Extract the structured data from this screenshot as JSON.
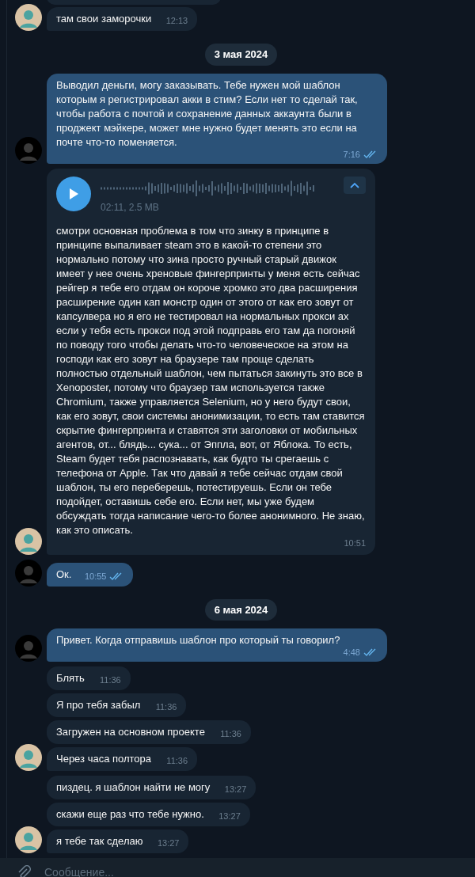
{
  "messages": [
    {
      "kind": "group",
      "outgoing": false,
      "cut_top": true,
      "messages": [
        {
          "kind": "text",
          "text": "там свои заморочки",
          "time": "12:13"
        }
      ]
    },
    {
      "kind": "date",
      "text": "3 мая 2024"
    },
    {
      "kind": "group",
      "outgoing": true,
      "messages": [
        {
          "kind": "text",
          "text": "Выводил деньги, могу заказывать. Тебе нужен мой шаблон которым я регистрировал акки в стим? Если нет то сделай так, чтобы работа с почтой и сохранение данных аккаунта были в проджект мэйкере, может мне нужно будет менять это если на почте что-то поменяется.",
          "time": "7:16",
          "read": true
        }
      ]
    },
    {
      "kind": "group",
      "outgoing": false,
      "messages": [
        {
          "kind": "voice",
          "meta": "02:11, 2.5 MB",
          "expanded": true,
          "text": "смотри основная проблема в том что зинку в принципе в принципе выпаливает steam это в какой-то степени это нормально потому что зина просто ручный старый движок имеет у нее очень хреновые фингерпринты у меня есть сейчас рейгер я тебе его отдам он короче хромко это два расширения расширение один кап монстр один от этого от как его зовут от капсулвера но я его не тестировал на нормальных прокси ах если у тебя есть прокси под этой подправь его там да погоняй по поводу того чтобы делать что-то человеческое на этом на господи как его зовут на браузере там проще сделать полностью отдельный шаблон, чем пытаться закинуть это все в Xenoposter, потому что браузер там используется также Chromium, также управляется Selenium, но у него будут свои, как его зовут, свои системы анонимизации, то есть там ставится скрытие фингерпринта и ставятся эти заголовки от мобильных агентов, от... блядь... сука... от Эппла, вот, от Яблока. То есть, Steam будет тебя распознавать, как будто ты срегаешь с телефона от Apple. Так что давай я тебе сейчас отдам свой шаблон, ты его переберешь, потестируешь. Если он тебе подойдет, оставишь себе его. Если нет, мы уже будем обсуждать тогда написание чего-то более анонимного. Не знаю, как это описать.",
          "time": "10:51"
        }
      ]
    },
    {
      "kind": "group",
      "outgoing": true,
      "messages": [
        {
          "kind": "text",
          "text": "Ок.",
          "time": "10:55",
          "read": true
        }
      ]
    },
    {
      "kind": "date",
      "text": "6 мая 2024"
    },
    {
      "kind": "group",
      "outgoing": true,
      "messages": [
        {
          "kind": "text",
          "text": "Привет. Когда отправишь шаблон про который ты говорил?",
          "time": "4:48",
          "read": true
        }
      ]
    },
    {
      "kind": "group",
      "outgoing": false,
      "messages": [
        {
          "kind": "text",
          "text": "Блять",
          "time": "11:36"
        },
        {
          "kind": "text",
          "text": "Я про тебя забыл",
          "time": "11:36"
        },
        {
          "kind": "text",
          "text": "Загружен на основном проекте",
          "time": "11:36"
        },
        {
          "kind": "text",
          "text": "Через часа полтора",
          "time": "11:36"
        }
      ]
    },
    {
      "kind": "group",
      "outgoing": false,
      "messages": [
        {
          "kind": "text",
          "text": "пиздец. я шаблон найти не могу",
          "time": "13:27"
        },
        {
          "kind": "text",
          "text": "скажи еще раз что тебе нужно.",
          "time": "13:27"
        },
        {
          "kind": "text",
          "text": "я тебе так сделаю",
          "time": "13:27"
        }
      ]
    }
  ],
  "composer": {
    "placeholder": "Сообщение..."
  }
}
